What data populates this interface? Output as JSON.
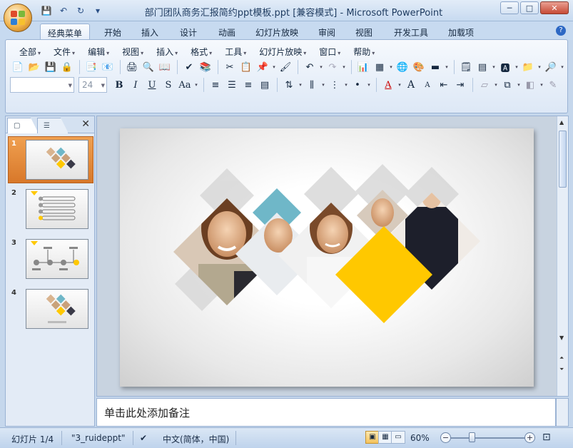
{
  "window": {
    "title": "部门团队商务汇报简约ppt模板.ppt [兼容模式] - Microsoft PowerPoint",
    "minimize": "─",
    "maximize": "□",
    "close": "✕"
  },
  "quick_access": {
    "more": "▾"
  },
  "tabs": [
    {
      "label": "经典菜单",
      "active": true
    },
    {
      "label": "开始"
    },
    {
      "label": "插入"
    },
    {
      "label": "设计"
    },
    {
      "label": "动画"
    },
    {
      "label": "幻灯片放映"
    },
    {
      "label": "审阅"
    },
    {
      "label": "视图"
    },
    {
      "label": "开发工具"
    },
    {
      "label": "加载项"
    }
  ],
  "menus": [
    "全部",
    "文件",
    "编辑",
    "视图",
    "插入",
    "格式",
    "工具",
    "幻灯片放映",
    "窗口",
    "帮助"
  ],
  "format": {
    "font_name": "",
    "font_size": "24",
    "bold": "B",
    "italic": "I",
    "underline": "U",
    "shadow": "S",
    "change_case": "Aa",
    "font_color": "A",
    "grow_font": "A",
    "shrink_font": "A"
  },
  "slides_pane": {
    "slide_numbers": [
      "1",
      "2",
      "3",
      "4"
    ],
    "close": "✕"
  },
  "notes": {
    "placeholder": "单击此处添加备注"
  },
  "status": {
    "slide_indicator": "幻灯片 1/4",
    "theme": "\"3_ruideppt\"",
    "language": "中文(简体，中国)",
    "zoom": "60%",
    "zoom_minus": "−",
    "zoom_plus": "+"
  },
  "colors": {
    "accent_yellow": "#ffc800",
    "teal": "#6fb7c8",
    "selection_orange": "#e08a3a",
    "ribbon_blue": "#c7daf0"
  }
}
